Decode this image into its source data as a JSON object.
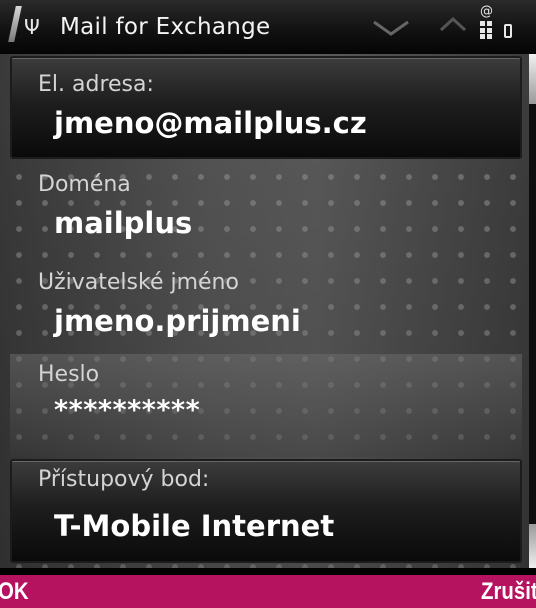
{
  "status_bar": {
    "title": "Mail for Exchange",
    "antenna_icon": "Ψ",
    "connection_icon": "@"
  },
  "fields": {
    "email": {
      "label": "El. adresa:",
      "value": "jmeno@mailplus.cz"
    },
    "domain": {
      "label": "Doména",
      "value": "mailplus"
    },
    "username": {
      "label": "Uživatelské jméno",
      "value": "jmeno.prijmeni"
    },
    "password": {
      "label": "Heslo",
      "value": "**********"
    },
    "access_point": {
      "label": "Přístupový bod:",
      "value": "T-Mobile Internet"
    }
  },
  "softkeys": {
    "left": "OK",
    "right": "Zrušit"
  },
  "colors": {
    "softkey_bar": "#b5125f",
    "background": "#000000",
    "text": "#ffffff"
  },
  "icons": [
    "signal-strength-icon",
    "antenna-icon",
    "mail-icon",
    "home-icon",
    "connection-icon",
    "packet-data-icon",
    "battery-icon"
  ]
}
